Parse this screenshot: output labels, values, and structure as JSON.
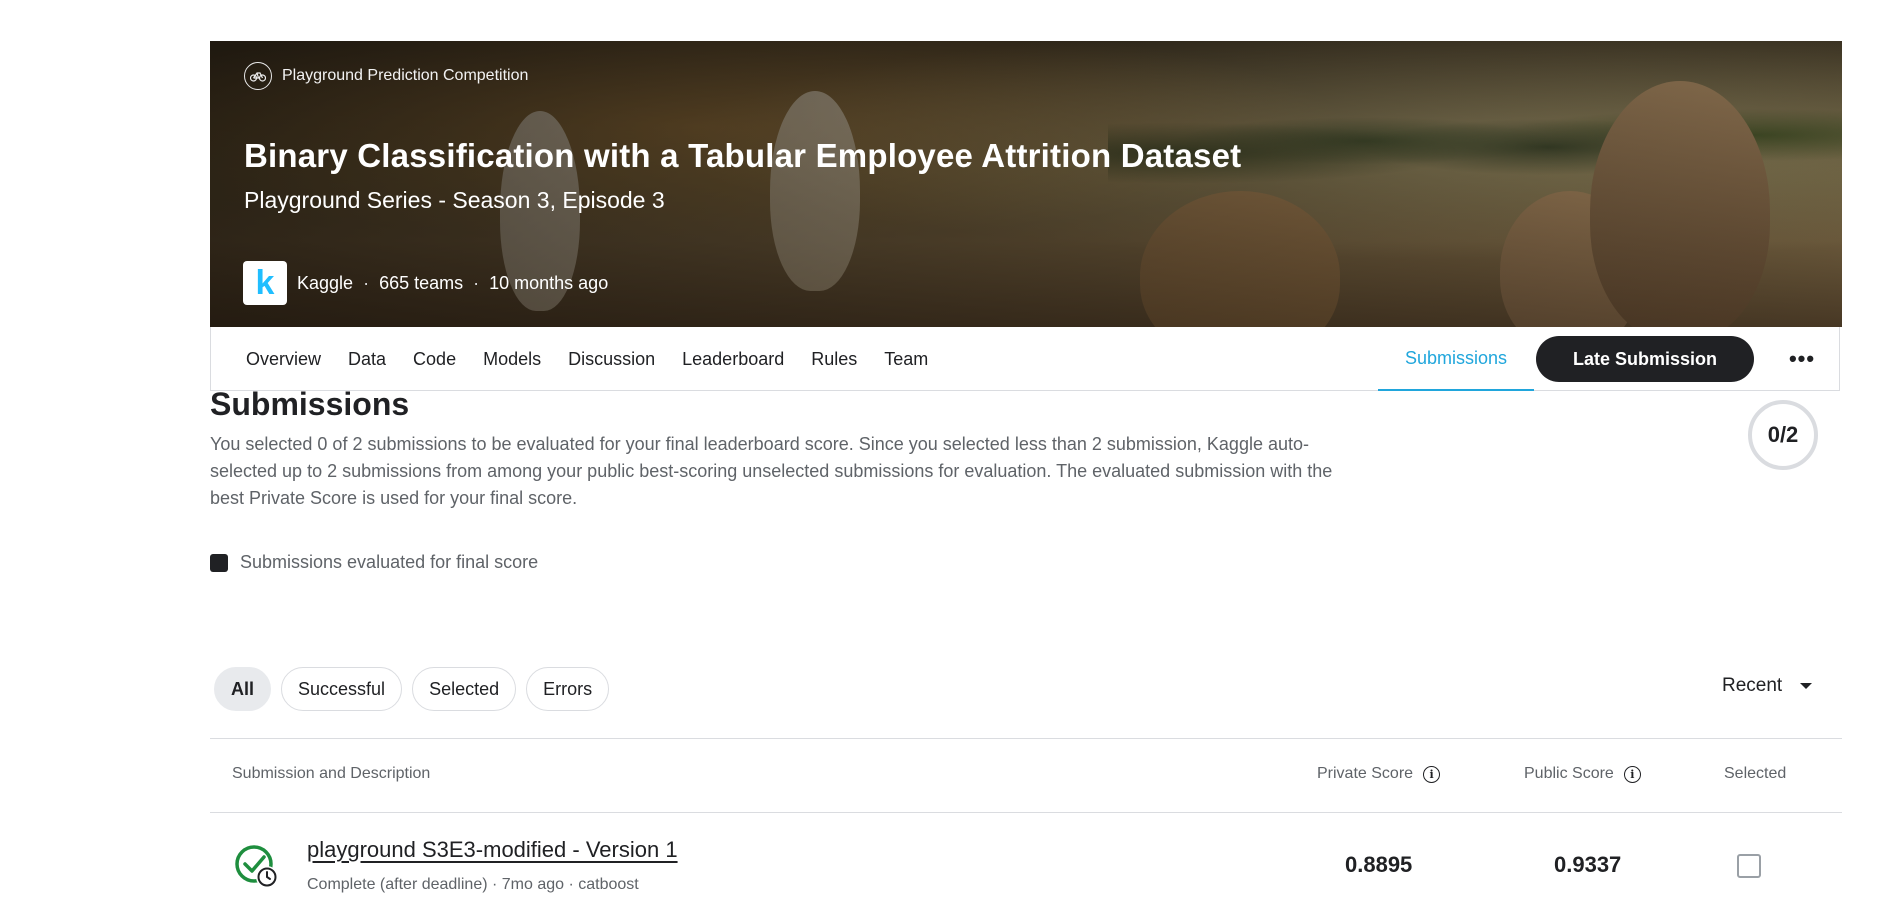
{
  "banner": {
    "competition_type": "Playground Prediction Competition",
    "competition_type_icon": "bicycle-icon",
    "title": "Binary Classification with a Tabular Employee Attrition Dataset",
    "subtitle": "Playground Series - Season 3, Episode 3",
    "host": "Kaggle",
    "logo_letter": "k",
    "teams": "665 teams",
    "time_ago": "10 months ago",
    "separator": "·"
  },
  "tabs": {
    "items": [
      "Overview",
      "Data",
      "Code",
      "Models",
      "Discussion",
      "Leaderboard",
      "Rules",
      "Team"
    ],
    "active": "Submissions",
    "late_submission": "Late Submission",
    "more": "•••"
  },
  "submissions": {
    "title": "Submissions",
    "description": "You selected 0 of 2 submissions to be evaluated for your final leaderboard score. Since you selected less than 2 submission, Kaggle auto-selected up to 2 submissions from among your public best-scoring unselected submissions for evaluation. The evaluated submission with the best Private Score is used for your final score.",
    "counter": "0/2",
    "legend": "Submissions evaluated for final score"
  },
  "filters": {
    "chips": [
      "All",
      "Successful",
      "Selected",
      "Errors"
    ],
    "active": "All",
    "sort": "Recent"
  },
  "table": {
    "headers": {
      "description": "Submission and Description",
      "private": "Private Score",
      "public": "Public Score",
      "selected": "Selected"
    },
    "rows": [
      {
        "name": "playground S3E3-modified - Version 1",
        "info": "Complete (after deadline) · 7mo ago · catboost",
        "private_score": "0.8895",
        "public_score": "0.9337",
        "selected": false
      }
    ]
  },
  "colors": {
    "accent": "#20a6dc",
    "dark": "#202124",
    "success": "#1e8e3e"
  }
}
